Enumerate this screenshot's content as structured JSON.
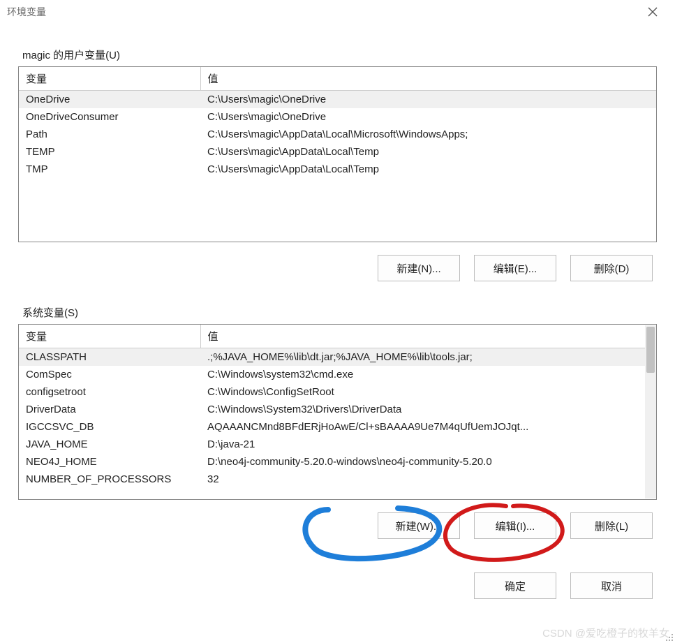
{
  "window": {
    "title": "环境变量"
  },
  "user_section": {
    "label": "magic 的用户变量(U)",
    "headers": {
      "var": "变量",
      "val": "值"
    },
    "rows": [
      {
        "var": "OneDrive",
        "val": "C:\\Users\\magic\\OneDrive",
        "selected": true
      },
      {
        "var": "OneDriveConsumer",
        "val": "C:\\Users\\magic\\OneDrive"
      },
      {
        "var": "Path",
        "val": "C:\\Users\\magic\\AppData\\Local\\Microsoft\\WindowsApps;"
      },
      {
        "var": "TEMP",
        "val": "C:\\Users\\magic\\AppData\\Local\\Temp"
      },
      {
        "var": "TMP",
        "val": "C:\\Users\\magic\\AppData\\Local\\Temp"
      }
    ],
    "buttons": {
      "new": "新建(N)...",
      "edit": "编辑(E)...",
      "delete": "删除(D)"
    }
  },
  "system_section": {
    "label": "系统变量(S)",
    "headers": {
      "var": "变量",
      "val": "值"
    },
    "rows": [
      {
        "var": "CLASSPATH",
        "val": ".;%JAVA_HOME%\\lib\\dt.jar;%JAVA_HOME%\\lib\\tools.jar;",
        "selected": true
      },
      {
        "var": "ComSpec",
        "val": "C:\\Windows\\system32\\cmd.exe"
      },
      {
        "var": "configsetroot",
        "val": "C:\\Windows\\ConfigSetRoot"
      },
      {
        "var": "DriverData",
        "val": "C:\\Windows\\System32\\Drivers\\DriverData"
      },
      {
        "var": "IGCCSVC_DB",
        "val": "AQAAANCMnd8BFdERjHoAwE/Cl+sBAAAA9Ue7M4qUfUemJOJqt..."
      },
      {
        "var": "JAVA_HOME",
        "val": "D:\\java-21"
      },
      {
        "var": "NEO4J_HOME",
        "val": "D:\\neo4j-community-5.20.0-windows\\neo4j-community-5.20.0"
      },
      {
        "var": "NUMBER_OF_PROCESSORS",
        "val": "32"
      }
    ],
    "buttons": {
      "new": "新建(W)...",
      "edit": "编辑(I)...",
      "delete": "删除(L)"
    }
  },
  "dialog_buttons": {
    "ok": "确定",
    "cancel": "取消"
  },
  "watermark": "CSDN @爱吃橙子的牧羊女"
}
